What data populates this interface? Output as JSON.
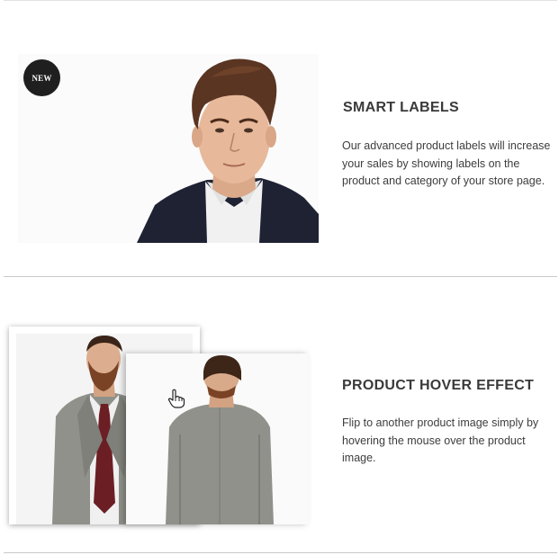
{
  "features": [
    {
      "badge": "NEW",
      "title": "SMART LABELS",
      "description_lines": [
        "Our advanced product labels will increase",
        "your sales by showing labels on the",
        "product and category of your store page."
      ]
    },
    {
      "title": "PRODUCT HOVER EFFECT",
      "description_lines": [
        "Flip to another product image simply by",
        "hovering the mouse over the product",
        "image."
      ]
    }
  ],
  "icons": {
    "cursor": "hand-pointer-icon"
  },
  "colors": {
    "badge_bg": "#1f1f1f",
    "divider": "#c9c9c9",
    "suit_jacket": "#8f918a",
    "navy_blazer": "#1e2233",
    "tie": "#6b1f24"
  }
}
